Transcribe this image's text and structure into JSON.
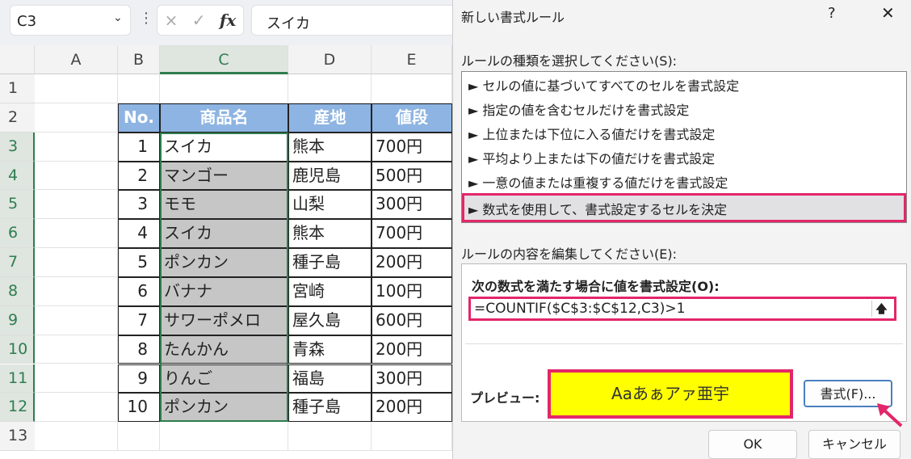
{
  "formula_bar": {
    "name_box": "C3",
    "cancel_icon": "×",
    "enter_icon": "✓",
    "fx": "fx",
    "content": "スイカ"
  },
  "columns": [
    "A",
    "B",
    "C",
    "D",
    "E"
  ],
  "rows": [
    "1",
    "2",
    "3",
    "4",
    "5",
    "6",
    "7",
    "8",
    "9",
    "10",
    "11",
    "12",
    "13"
  ],
  "table": {
    "headers": [
      "No.",
      "商品名",
      "産地",
      "値段"
    ],
    "data": [
      [
        "1",
        "スイカ",
        "熊本",
        "700円"
      ],
      [
        "2",
        "マンゴー",
        "鹿児島",
        "500円"
      ],
      [
        "3",
        "モモ",
        "山梨",
        "300円"
      ],
      [
        "4",
        "スイカ",
        "熊本",
        "700円"
      ],
      [
        "5",
        "ポンカン",
        "種子島",
        "200円"
      ],
      [
        "6",
        "バナナ",
        "宮崎",
        "100円"
      ],
      [
        "7",
        "サワーポメロ",
        "屋久島",
        "600円"
      ],
      [
        "8",
        "たんかん",
        "青森",
        "200円"
      ],
      [
        "9",
        "りんご",
        "福島",
        "300円"
      ],
      [
        "10",
        "ポンカン",
        "種子島",
        "200円"
      ]
    ]
  },
  "dialog": {
    "title": "新しい書式ルール",
    "help": "?",
    "close": "✕",
    "rule_type_label": "ルールの種類を選択してください(S):",
    "rule_types": [
      "セルの値に基づいてすべてのセルを書式設定",
      "指定の値を含むセルだけを書式設定",
      "上位または下位に入る値だけを書式設定",
      "平均より上または下の値だけを書式設定",
      "一意の値または重複する値だけを書式設定",
      "数式を使用して、書式設定するセルを決定"
    ],
    "arrow": "►",
    "edit_label": "ルールの内容を編集してください(E):",
    "formula_label": "次の数式を満たす場合に値を書式設定(O):",
    "formula": "=COUNTIF($C$3:$C$12,C3)>1",
    "preview_label": "プレビュー:",
    "preview_text": "Aaあぁアァ亜宇",
    "format_button": "書式(F)...",
    "ok": "OK",
    "cancel": "キャンセル"
  }
}
